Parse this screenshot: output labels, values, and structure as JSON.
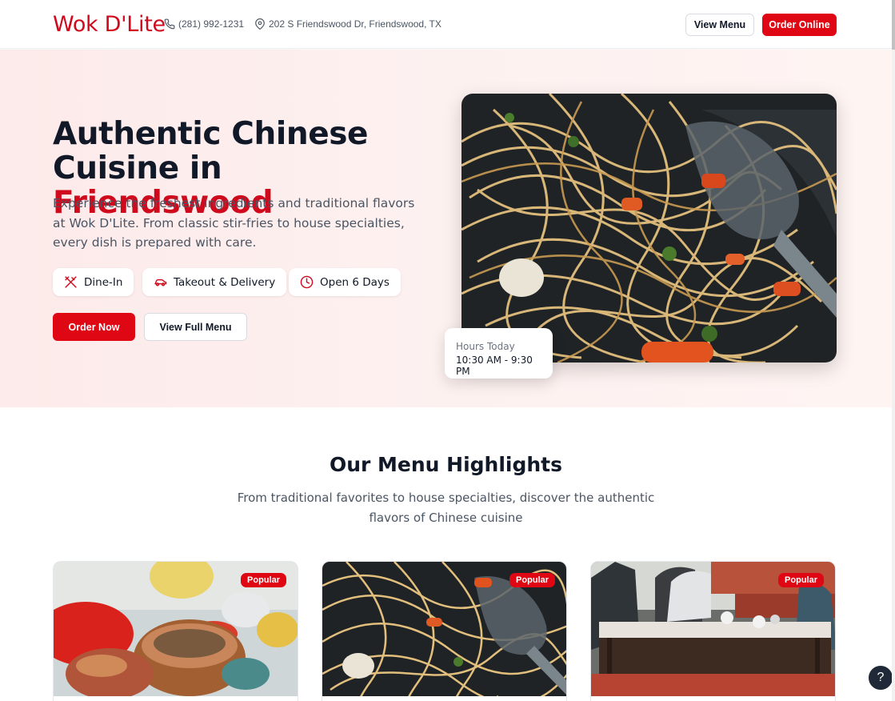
{
  "header": {
    "brand": "Wok D'Lite",
    "phone": "(281) 992-1231",
    "address": "202 S Friendswood Dr, Friendswood, TX",
    "view_menu": "View Menu",
    "order_online": "Order Online"
  },
  "hero": {
    "title_line1": "Authentic Chinese",
    "title_line2_prefix": "Cuisine in ",
    "title_accent": "Friendswood",
    "description": "Experience the freshest ingredients and traditional flavors at Wok D'Lite. From classic stir-fries to house specialties, every dish is prepared with care.",
    "pills": {
      "dine_in": "Dine-In",
      "takeout": "Takeout & Delivery",
      "open": "Open 6 Days"
    },
    "order_now": "Order Now",
    "view_full_menu": "View Full Menu",
    "hours_label": "Hours Today",
    "hours_value": "10:30 AM - 9:30 PM"
  },
  "highlights": {
    "title": "Our Menu Highlights",
    "subtitle": "From traditional favorites to house specialties, discover the authentic flavors of Chinese cuisine",
    "cards": [
      {
        "badge": "Popular"
      },
      {
        "badge": "Popular"
      },
      {
        "badge": "Popular"
      }
    ]
  },
  "help": {
    "label": "?"
  },
  "colors": {
    "brand_red": "#d00a1d",
    "button_red": "#e00714",
    "hero_bg": "#fdeeed"
  }
}
